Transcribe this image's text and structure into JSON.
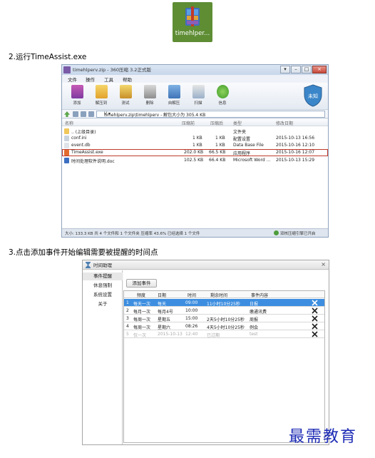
{
  "top_icon": {
    "caption": "timehlper..."
  },
  "steps": {
    "run": "2.运行TimeAssist.exe",
    "add": "3.点击添加事件开始编辑需要被提醒的时间点"
  },
  "archive": {
    "title": "timehlperv.zip - 360压缩 3.2正式版",
    "menu": [
      "文件",
      "操作",
      "工具",
      "帮助"
    ],
    "tools": [
      "添加",
      "解压到",
      "测试",
      "删除",
      "自解压",
      "扫描",
      "信息"
    ],
    "shield_label": "未知",
    "path": "timehlperv.zip\\timehlperv - 解包大小为 305.4 KB",
    "columns": [
      "名称",
      "压缩前",
      "压缩后",
      "类型",
      "修改日期"
    ],
    "rows": [
      {
        "name": ".. (上级目录)",
        "size": "",
        "packed": "",
        "type": "文件夹",
        "date": ""
      },
      {
        "name": "conf.ini",
        "size": "1 KB",
        "packed": "1 KB",
        "type": "配置设置",
        "date": "2015-10-13 16:56"
      },
      {
        "name": "event.db",
        "size": "1 KB",
        "packed": "1 KB",
        "type": "Data Base File",
        "date": "2015-10-16 12:10"
      },
      {
        "name": "TimeAssist.exe",
        "size": "202.0 KB",
        "packed": "66.5 KB",
        "type": "应用程序",
        "date": "2015-10-16 12:07"
      },
      {
        "name": "时间处理软件说明.doc",
        "size": "102.5 KB",
        "packed": "66.4 KB",
        "type": "Microsoft Word ...",
        "date": "2015-10-13 15:29"
      }
    ],
    "status_left": "大小: 133.3 KB 共 4 个文件和 1 个文件夹 压缩率 43.6% 已经选择 1 个文件",
    "status_right": "双核压缩引擎已开启"
  },
  "timeassist": {
    "title": "时间助理",
    "sidebar": [
      "事件提醒",
      "休息强制",
      "系统设置",
      "关于"
    ],
    "add_button": "添加事件",
    "columns": [
      "频度",
      "日期",
      "时间",
      "剩余时间",
      "事件内容"
    ],
    "rows": [
      {
        "no": "1",
        "freq": "每天一次",
        "date": "每天",
        "time": "09:00",
        "remain": "11小时10分25秒",
        "content": "日报"
      },
      {
        "no": "2",
        "freq": "每月一次",
        "date": "每月4号",
        "time": "10:00",
        "remain": "",
        "content": "缴通讯费"
      },
      {
        "no": "3",
        "freq": "每周一次",
        "date": "星期五",
        "time": "15:00",
        "remain": "2天5小时10分25秒",
        "content": "周报"
      },
      {
        "no": "4",
        "freq": "每周一次",
        "date": "星期六",
        "time": "08:26",
        "remain": "4天5小时10分25秒",
        "content": "例会"
      },
      {
        "no": "5",
        "freq": "仅一次",
        "date": "2015-10-13",
        "time": "12:40",
        "remain": "已过期",
        "content": "test"
      }
    ]
  },
  "logo": "最需教育",
  "colors": {
    "icon_bg": "#5e8d34",
    "selection": "#3d8ee0",
    "highlight_border": "#c0392b",
    "logo": "#1d2bb5"
  }
}
